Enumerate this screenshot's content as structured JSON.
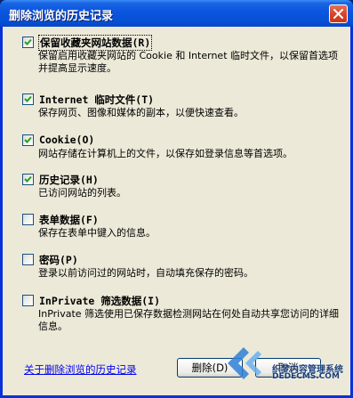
{
  "window": {
    "title": "删除浏览的历史记录",
    "title_color": "#0a55de"
  },
  "sections": [
    {
      "title": "保留收藏夹网站数据(R)",
      "checked": true,
      "description": "保留启用收藏夹网站的 Cookie 和 Internet 临时文件，以保留首选项并提高显示速度。"
    },
    {
      "title": "Internet 临时文件(T)",
      "checked": true,
      "description": "保存网页、图像和媒体的副本，以便快速查看。"
    },
    {
      "title": "Cookie(O)",
      "checked": true,
      "description": "网站存储在计算机上的文件，以保存如登录信息等首选项。"
    },
    {
      "title": "历史记录(H)",
      "checked": true,
      "description": "已访问网站的列表。"
    },
    {
      "title": "表单数据(F)",
      "checked": false,
      "description": "保存在表单中键入的信息。"
    },
    {
      "title": "密码(P)",
      "checked": false,
      "description": "登录以前访问过的网站时，自动填充保存的密码。"
    },
    {
      "title": "InPrivate 筛选数据(I)",
      "checked": false,
      "description": "InPrivate 筛选使用已保存数据检测网站在何处自动共享您访问的详细信息。"
    }
  ],
  "footer": {
    "help_link": "关于删除浏览的历史记录",
    "delete_button": "删除(D)",
    "cancel_button": "取消"
  },
  "watermark": {
    "line1": "织梦内容管理系统",
    "line2": "DEDECMS.COM"
  }
}
